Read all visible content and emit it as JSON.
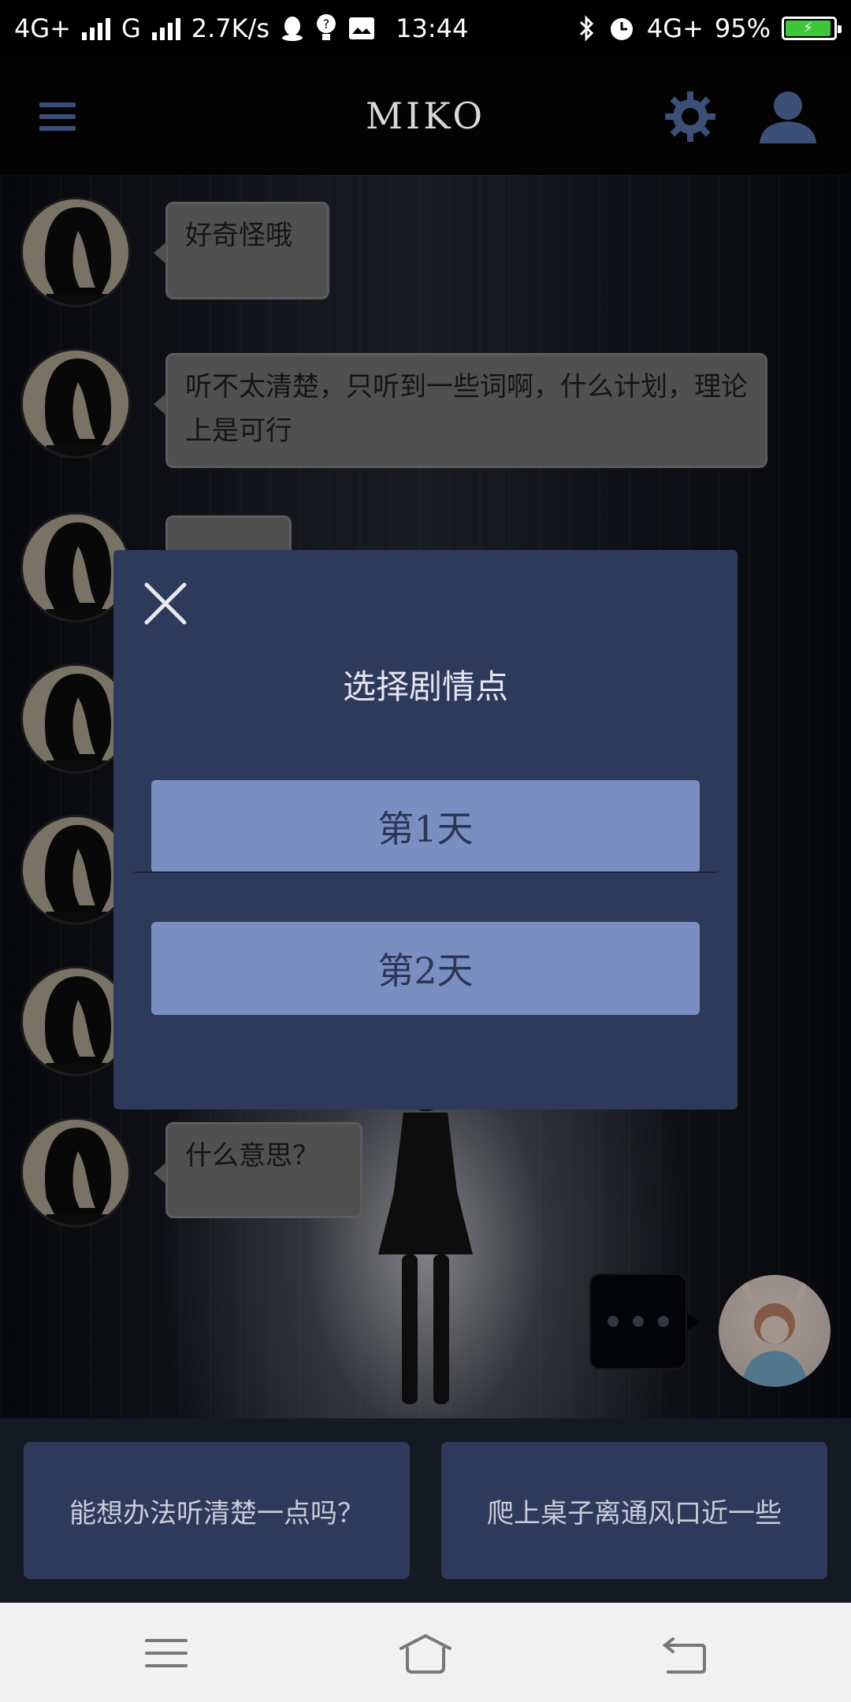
{
  "status_bar": {
    "network1": "4G+",
    "network2": "G",
    "speed": "2.7K/s",
    "time": "13:44",
    "network3": "4G+",
    "battery_percent": "95%",
    "battery_level": 0.95,
    "icons": [
      "signal-icon",
      "qq-icon",
      "hint-icon",
      "image-icon",
      "bluetooth-icon",
      "alarm-icon",
      "battery-icon"
    ]
  },
  "header": {
    "title": "MIKO",
    "left_icon": "hamburger-menu-icon",
    "right_icons": [
      "gear-icon",
      "user-icon"
    ]
  },
  "messages": [
    {
      "text": "好奇怪哦"
    },
    {
      "text": "听不太清楚，只听到一些词啊，什么计划，理论上是可行"
    },
    {
      "text": ""
    },
    {
      "text": ""
    },
    {
      "text": ""
    },
    {
      "text": ""
    },
    {
      "text": "什么意思？"
    }
  ],
  "modal": {
    "title": "选择剧情点",
    "options": [
      "第1天",
      "第2天"
    ],
    "close_icon": "close-icon"
  },
  "replies": [
    "能想办法听清楚一点吗？",
    "爬上桌子离通风口近一些"
  ],
  "nav": [
    "menu-icon",
    "home-icon",
    "back-icon"
  ],
  "colors": {
    "modal_bg": "#2d3a5b",
    "option_bg": "#7b8ec1",
    "bubble_bg": "#7c7c7c",
    "battery_fill": "#3ec53b"
  }
}
